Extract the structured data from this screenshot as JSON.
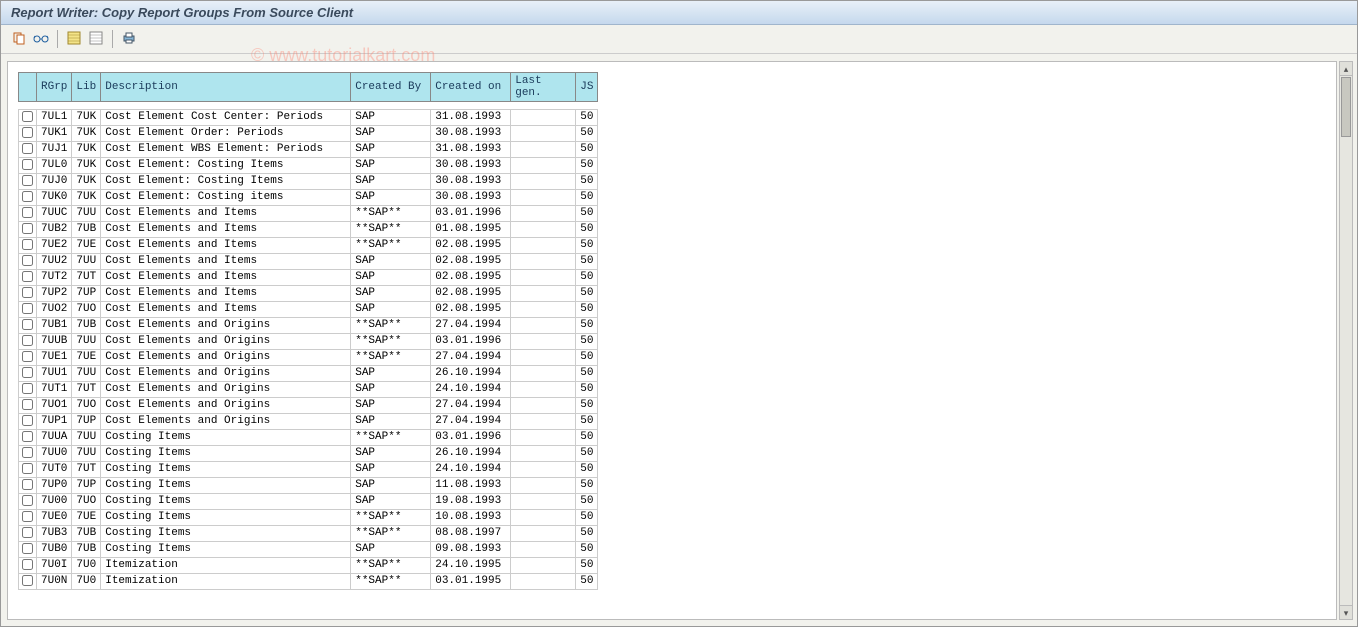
{
  "title": "Report Writer: Copy Report Groups From Source Client",
  "watermark": "© www.tutorialkart.com",
  "toolbar": {
    "copy": "copy-icon",
    "glasses": "display-icon",
    "select_all": "select-all-icon",
    "deselect_all": "deselect-all-icon",
    "print": "print-icon"
  },
  "columns": {
    "chk": "",
    "rgrp": "RGrp",
    "lib": "Lib",
    "desc": "Description",
    "cby": "Created By",
    "con": "Created on",
    "lgen": "Last gen.",
    "js": "JS"
  },
  "rows": [
    {
      "rgrp": "7UL1",
      "lib": "7UK",
      "desc": "Cost Element Cost Center: Periods",
      "cby": "SAP",
      "con": "31.08.1993",
      "lgen": "",
      "js": "50"
    },
    {
      "rgrp": "7UK1",
      "lib": "7UK",
      "desc": "Cost Element Order: Periods",
      "cby": "SAP",
      "con": "30.08.1993",
      "lgen": "",
      "js": "50"
    },
    {
      "rgrp": "7UJ1",
      "lib": "7UK",
      "desc": "Cost Element WBS Element: Periods",
      "cby": "SAP",
      "con": "31.08.1993",
      "lgen": "",
      "js": "50"
    },
    {
      "rgrp": "7UL0",
      "lib": "7UK",
      "desc": "Cost Element: Costing Items",
      "cby": "SAP",
      "con": "30.08.1993",
      "lgen": "",
      "js": "50"
    },
    {
      "rgrp": "7UJ0",
      "lib": "7UK",
      "desc": "Cost Element: Costing Items",
      "cby": "SAP",
      "con": "30.08.1993",
      "lgen": "",
      "js": "50"
    },
    {
      "rgrp": "7UK0",
      "lib": "7UK",
      "desc": "Cost Element: Costing items",
      "cby": "SAP",
      "con": "30.08.1993",
      "lgen": "",
      "js": "50"
    },
    {
      "rgrp": "7UUC",
      "lib": "7UU",
      "desc": "Cost Elements and Items",
      "cby": "**SAP**",
      "con": "03.01.1996",
      "lgen": "",
      "js": "50"
    },
    {
      "rgrp": "7UB2",
      "lib": "7UB",
      "desc": "Cost Elements and Items",
      "cby": "**SAP**",
      "con": "01.08.1995",
      "lgen": "",
      "js": "50"
    },
    {
      "rgrp": "7UE2",
      "lib": "7UE",
      "desc": "Cost Elements and Items",
      "cby": "**SAP**",
      "con": "02.08.1995",
      "lgen": "",
      "js": "50"
    },
    {
      "rgrp": "7UU2",
      "lib": "7UU",
      "desc": "Cost Elements and Items",
      "cby": "SAP",
      "con": "02.08.1995",
      "lgen": "",
      "js": "50"
    },
    {
      "rgrp": "7UT2",
      "lib": "7UT",
      "desc": "Cost Elements and Items",
      "cby": "SAP",
      "con": "02.08.1995",
      "lgen": "",
      "js": "50"
    },
    {
      "rgrp": "7UP2",
      "lib": "7UP",
      "desc": "Cost Elements and Items",
      "cby": "SAP",
      "con": "02.08.1995",
      "lgen": "",
      "js": "50"
    },
    {
      "rgrp": "7UO2",
      "lib": "7UO",
      "desc": "Cost Elements and Items",
      "cby": "SAP",
      "con": "02.08.1995",
      "lgen": "",
      "js": "50"
    },
    {
      "rgrp": "7UB1",
      "lib": "7UB",
      "desc": "Cost Elements and Origins",
      "cby": "**SAP**",
      "con": "27.04.1994",
      "lgen": "",
      "js": "50"
    },
    {
      "rgrp": "7UUB",
      "lib": "7UU",
      "desc": "Cost Elements and Origins",
      "cby": "**SAP**",
      "con": "03.01.1996",
      "lgen": "",
      "js": "50"
    },
    {
      "rgrp": "7UE1",
      "lib": "7UE",
      "desc": "Cost Elements and Origins",
      "cby": "**SAP**",
      "con": "27.04.1994",
      "lgen": "",
      "js": "50"
    },
    {
      "rgrp": "7UU1",
      "lib": "7UU",
      "desc": "Cost Elements and Origins",
      "cby": "SAP",
      "con": "26.10.1994",
      "lgen": "",
      "js": "50"
    },
    {
      "rgrp": "7UT1",
      "lib": "7UT",
      "desc": "Cost Elements and Origins",
      "cby": "SAP",
      "con": "24.10.1994",
      "lgen": "",
      "js": "50"
    },
    {
      "rgrp": "7UO1",
      "lib": "7UO",
      "desc": "Cost Elements and Origins",
      "cby": "SAP",
      "con": "27.04.1994",
      "lgen": "",
      "js": "50"
    },
    {
      "rgrp": "7UP1",
      "lib": "7UP",
      "desc": "Cost Elements and Origins",
      "cby": "SAP",
      "con": "27.04.1994",
      "lgen": "",
      "js": "50"
    },
    {
      "rgrp": "7UUA",
      "lib": "7UU",
      "desc": "Costing Items",
      "cby": "**SAP**",
      "con": "03.01.1996",
      "lgen": "",
      "js": "50"
    },
    {
      "rgrp": "7UU0",
      "lib": "7UU",
      "desc": "Costing Items",
      "cby": "SAP",
      "con": "26.10.1994",
      "lgen": "",
      "js": "50"
    },
    {
      "rgrp": "7UT0",
      "lib": "7UT",
      "desc": "Costing Items",
      "cby": "SAP",
      "con": "24.10.1994",
      "lgen": "",
      "js": "50"
    },
    {
      "rgrp": "7UP0",
      "lib": "7UP",
      "desc": "Costing Items",
      "cby": "SAP",
      "con": "11.08.1993",
      "lgen": "",
      "js": "50"
    },
    {
      "rgrp": "7U00",
      "lib": "7UO",
      "desc": "Costing Items",
      "cby": "SAP",
      "con": "19.08.1993",
      "lgen": "",
      "js": "50"
    },
    {
      "rgrp": "7UE0",
      "lib": "7UE",
      "desc": "Costing Items",
      "cby": "**SAP**",
      "con": "10.08.1993",
      "lgen": "",
      "js": "50"
    },
    {
      "rgrp": "7UB3",
      "lib": "7UB",
      "desc": "Costing Items",
      "cby": "**SAP**",
      "con": "08.08.1997",
      "lgen": "",
      "js": "50"
    },
    {
      "rgrp": "7UB0",
      "lib": "7UB",
      "desc": "Costing Items",
      "cby": "SAP",
      "con": "09.08.1993",
      "lgen": "",
      "js": "50"
    },
    {
      "rgrp": "7U0I",
      "lib": "7U0",
      "desc": "Itemization",
      "cby": "**SAP**",
      "con": "24.10.1995",
      "lgen": "",
      "js": "50"
    },
    {
      "rgrp": "7U0N",
      "lib": "7U0",
      "desc": "Itemization",
      "cby": "**SAP**",
      "con": "03.01.1995",
      "lgen": "",
      "js": "50"
    }
  ]
}
